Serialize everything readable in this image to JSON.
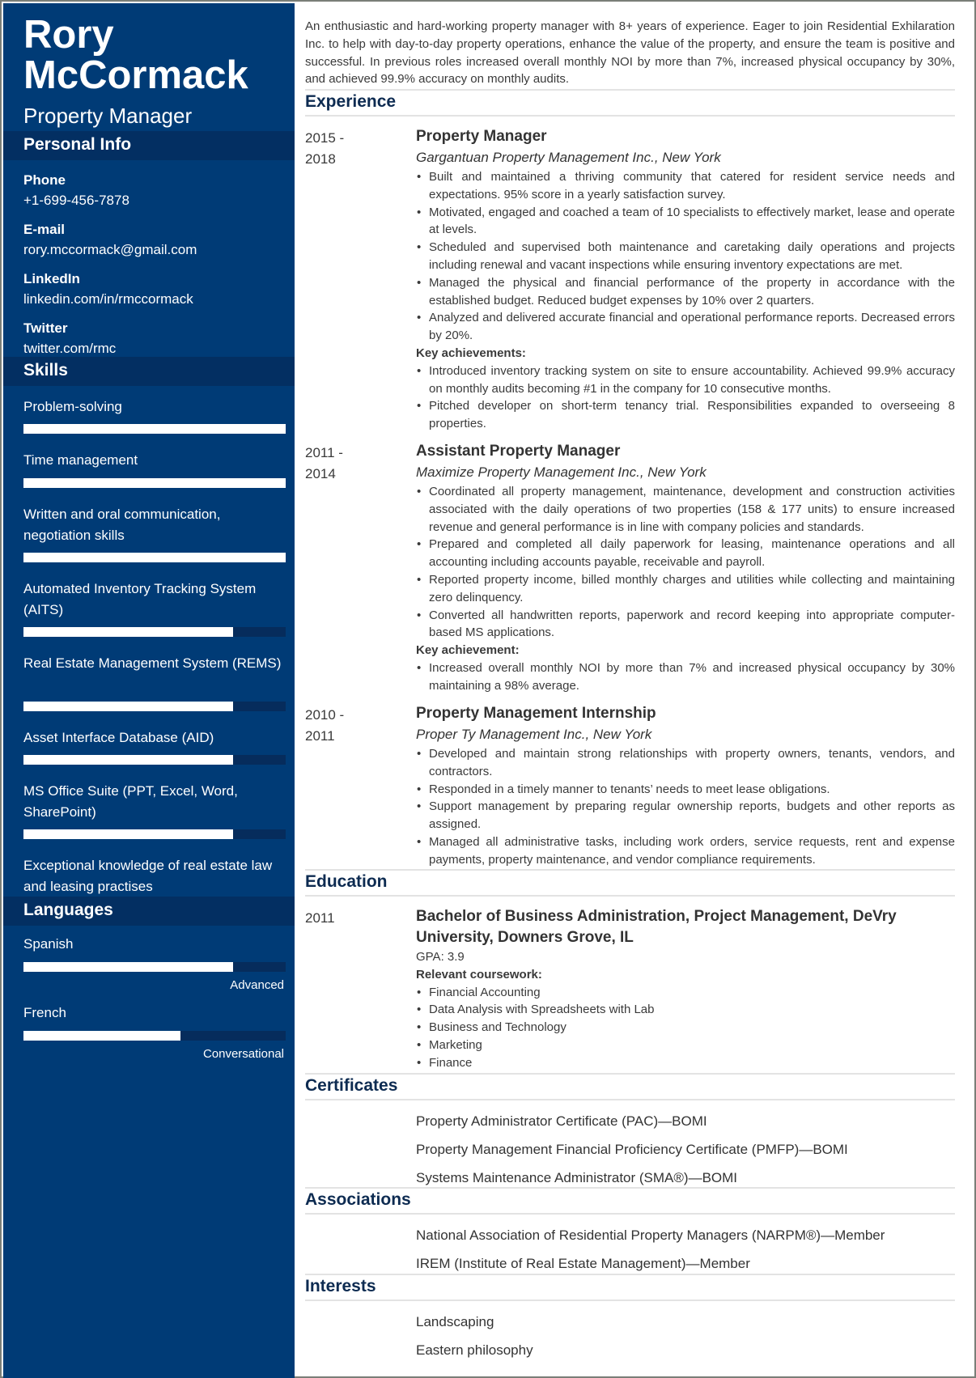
{
  "header": {
    "name_first": "Rory",
    "name_last": "McCormack",
    "title": "Property Manager"
  },
  "colors": {
    "sidebar": "#003b76",
    "sidebar_band": "#032f62",
    "section_heading": "#0d2b51",
    "bar_fill": "#ffffff",
    "bar_track": "#062c5c"
  },
  "sidebar": {
    "personal_info": {
      "heading": "Personal Info",
      "fields": [
        {
          "label": "Phone",
          "value": "+1-699-456-7878"
        },
        {
          "label": "E-mail",
          "value": "rory.mccormack@gmail.com"
        },
        {
          "label": "LinkedIn",
          "value": "linkedin.com/in/rmccormack"
        },
        {
          "label": "Twitter",
          "value": "twitter.com/rmc"
        }
      ]
    },
    "skills": {
      "heading": "Skills",
      "items": [
        {
          "name": "Problem-solving",
          "level": 1.0
        },
        {
          "name": "Time management",
          "level": 1.0
        },
        {
          "name": "Written and oral communication, negotiation skills",
          "level": 1.0
        },
        {
          "name": "Automated Inventory Tracking System (AITS)",
          "level": 0.8
        },
        {
          "name": "Real Estate Management System (REMS)",
          "level": 0.8
        },
        {
          "name": "Asset Interface Database (AID)",
          "level": 0.8
        },
        {
          "name": "MS Office Suite (PPT, Excel, Word, SharePoint)",
          "level": 0.8
        },
        {
          "name": "Exceptional knowledge of real estate law and leasing practises",
          "level": null
        }
      ]
    },
    "languages": {
      "heading": "Languages",
      "items": [
        {
          "name": "Spanish",
          "level": 0.8,
          "level_label": "Advanced"
        },
        {
          "name": "French",
          "level": 0.6,
          "level_label": "Conversational"
        }
      ]
    }
  },
  "main": {
    "summary": "An enthusiastic and hard-working property manager with 8+ years of experience. Eager to join Residential Exhilaration Inc. to help with day-to-day property operations, enhance the value of the property, and ensure the team is positive and successful. In previous roles increased overall monthly NOI by more than 7%, increased physical occupancy by 30%, and achieved 99.9% accuracy on monthly audits.",
    "experience": {
      "heading": "Experience",
      "jobs": [
        {
          "date_start": "2015 -",
          "date_end": "2018",
          "title": "Property Manager",
          "org": "Gargantuan Property Management Inc., New York",
          "bullets": [
            "Built and maintained a thriving community that catered for resident service needs and expectations. 95% score in a yearly satisfaction survey.",
            "Motivated, engaged and coached a team of 10 specialists to effectively market, lease and operate at levels.",
            "Scheduled and supervised both maintenance and caretaking daily operations and projects including renewal and vacant inspections while ensuring inventory expectations are met.",
            "Managed the physical and financial performance of the property in accordance with the established budget. Reduced budget expenses by 10% over 2 quarters.",
            "Analyzed and delivered accurate financial and operational performance reports. Decreased errors by 20%."
          ],
          "key_heading": "Key achievements:",
          "key_bullets": [
            "Introduced inventory tracking system on site to ensure accountability. Achieved 99.9% accuracy on monthly audits becoming #1 in the company for 10 consecutive months.",
            "Pitched developer on short-term tenancy trial. Responsibilities expanded to overseeing 8 properties."
          ]
        },
        {
          "date_start": "2011 -",
          "date_end": "2014",
          "title": "Assistant Property Manager",
          "org": "Maximize Property Management Inc., New York",
          "bullets": [
            "Coordinated all property management, maintenance, development and construction activities associated with the daily operations of two properties (158 & 177 units) to ensure increased revenue and general performance is in line with company policies and standards.",
            "Prepared and completed all daily paperwork for leasing, maintenance operations and all accounting including accounts payable, receivable and payroll.",
            "Reported property income, billed monthly charges and utilities while collecting and maintaining zero delinquency.",
            "Converted all handwritten reports, paperwork and record keeping into appropriate computer-based MS applications."
          ],
          "key_heading": "Key achievement:",
          "key_bullets": [
            "Increased overall monthly NOI by more than 7% and increased physical occupancy by 30% maintaining a 98% average."
          ]
        },
        {
          "date_start": "2010 -",
          "date_end": "2011",
          "title": "Property Management Internship",
          "org": "Proper Ty Management Inc., New York",
          "bullets": [
            "Developed and maintain strong relationships with property owners, tenants, vendors, and contractors.",
            "Responded in a timely manner to tenants’ needs to meet lease obligations.",
            "Support management by preparing regular ownership reports, budgets and other reports as assigned.",
            "Managed all administrative tasks, including work orders, service requests, rent and expense payments, property maintenance, and vendor compliance requirements."
          ]
        }
      ]
    },
    "education": {
      "heading": "Education",
      "date": "2011",
      "degree": "Bachelor of Business Administration, Project Management,  DeVry University, Downers Grove, IL",
      "gpa": "GPA: 3.9",
      "coursework_heading": "Relevant coursework:",
      "coursework": [
        "Financial Accounting",
        "Data Analysis with Spreadsheets with Lab",
        "Business and Technology",
        "Marketing",
        "Finance"
      ]
    },
    "certificates": {
      "heading": "Certificates",
      "items": [
        "Property Administrator Certificate (PAC)—BOMI",
        "Property Management Financial Proficiency Certificate (PMFP)—BOMI",
        "Systems Maintenance Administrator (SMA®)—BOMI"
      ]
    },
    "associations": {
      "heading": "Associations",
      "items": [
        "National Association of Residential Property Managers (NARPM®)—Member",
        "IREM (Institute of Real Estate Management)—Member"
      ]
    },
    "interests": {
      "heading": "Interests",
      "items": [
        "Landscaping",
        "Eastern philosophy"
      ]
    }
  }
}
